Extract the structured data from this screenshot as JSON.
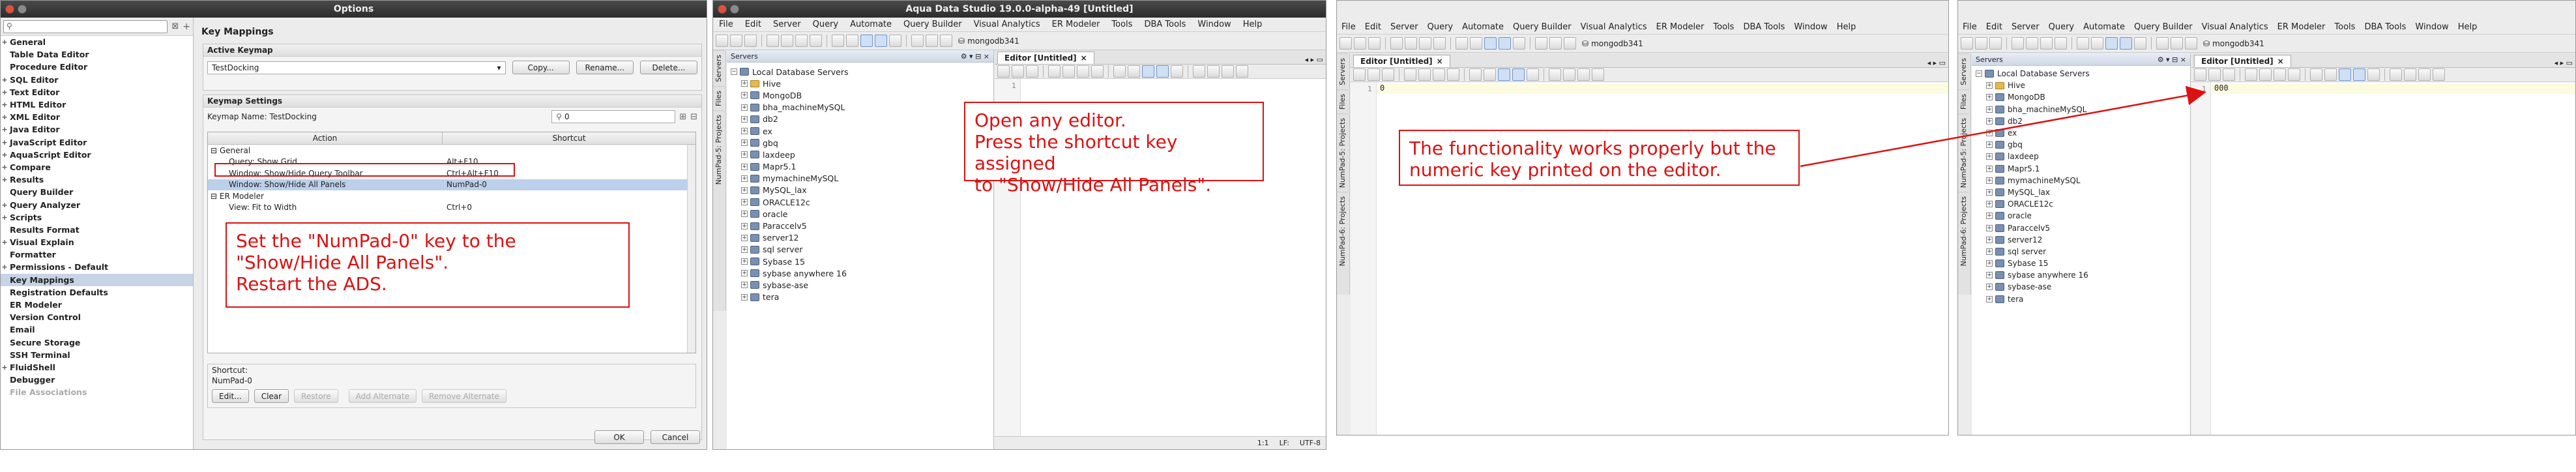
{
  "options": {
    "title": "Options",
    "nav": [
      {
        "label": "General",
        "pm": "+"
      },
      {
        "label": "Table Data Editor",
        "pm": ""
      },
      {
        "label": "Procedure Editor",
        "pm": ""
      },
      {
        "label": "SQL Editor",
        "pm": "+"
      },
      {
        "label": "Text Editor",
        "pm": "+"
      },
      {
        "label": "HTML Editor",
        "pm": "+"
      },
      {
        "label": "XML Editor",
        "pm": "+"
      },
      {
        "label": "Java Editor",
        "pm": "+"
      },
      {
        "label": "JavaScript Editor",
        "pm": "+"
      },
      {
        "label": "AquaScript Editor",
        "pm": "+"
      },
      {
        "label": "Compare",
        "pm": "+"
      },
      {
        "label": "Results",
        "pm": "+"
      },
      {
        "label": "Query Builder",
        "pm": ""
      },
      {
        "label": "Query Analyzer",
        "pm": "+"
      },
      {
        "label": "Scripts",
        "pm": "+"
      },
      {
        "label": "Results Format",
        "pm": ""
      },
      {
        "label": "Visual Explain",
        "pm": "+"
      },
      {
        "label": "Formatter",
        "pm": ""
      },
      {
        "label": "Permissions - Default",
        "pm": "+"
      },
      {
        "label": "Key Mappings",
        "pm": ""
      },
      {
        "label": "Registration Defaults",
        "pm": ""
      },
      {
        "label": "ER Modeler",
        "pm": ""
      },
      {
        "label": "Version Control",
        "pm": ""
      },
      {
        "label": "Email",
        "pm": ""
      },
      {
        "label": "Secure Storage",
        "pm": ""
      },
      {
        "label": "SSH Terminal",
        "pm": ""
      },
      {
        "label": "FluidShell",
        "pm": "+"
      },
      {
        "label": "Debugger",
        "pm": ""
      },
      {
        "label": "File Associations",
        "pm": ""
      }
    ],
    "section_title": "Key Mappings",
    "active_keymap_label": "Active Keymap",
    "active_keymap_value": "TestDocking",
    "copy_btn": "Copy...",
    "rename_btn": "Rename...",
    "delete_btn": "Delete...",
    "keymap_settings_label": "Keymap Settings",
    "keymap_name_label": "Keymap Name: TestDocking",
    "search_value": "0",
    "col_action": "Action",
    "col_shortcut": "Shortcut",
    "rows": [
      {
        "action": "General",
        "shortcut": "",
        "indent": 0,
        "pm": "⊟"
      },
      {
        "action": "Query: Show Grid",
        "shortcut": "Alt+F10",
        "indent": 2,
        "pm": ""
      },
      {
        "action": "Window: Show/Hide Query Toolbar",
        "shortcut": "Ctrl+Alt+F10",
        "indent": 2,
        "pm": ""
      },
      {
        "action": "Window: Show/Hide All Panels",
        "shortcut": "NumPad-0",
        "indent": 2,
        "pm": ""
      },
      {
        "action": "ER Modeler",
        "shortcut": "",
        "indent": 0,
        "pm": "⊟"
      },
      {
        "action": "View: Fit to Width",
        "shortcut": "Ctrl+0",
        "indent": 2,
        "pm": ""
      }
    ],
    "shortcut_group_label": "Shortcut:",
    "shortcut_value": "NumPad-0",
    "edit_btn": "Edit...",
    "clear_btn": "Clear",
    "restore_btn": "Restore",
    "add_alt_btn": "Add Alternate",
    "remove_alt_btn": "Remove Alternate",
    "ok_btn": "OK",
    "cancel_btn": "Cancel",
    "callout": "Set the \"NumPad-0\" key to the \"Show/Hide All Panels\".\nRestart the ADS."
  },
  "ads": {
    "title": "Aqua Data Studio 19.0.0-alpha-49 [Untitled]",
    "menus": [
      "File",
      "Edit",
      "Server",
      "Query",
      "Automate",
      "Query Builder",
      "Visual Analytics",
      "ER Modeler",
      "Tools",
      "DBA Tools",
      "Window",
      "Help"
    ],
    "server_combo": "mongodb341",
    "side_tabs": [
      "Servers",
      "Files",
      "NumPad-5: Projects",
      "NumPad-6: Projects"
    ],
    "side_tabs_short": [
      "Servers",
      "Files",
      "NumPad-5: Projects"
    ],
    "servers_title": "Servers",
    "servers": [
      "Local Database Servers",
      "Hive",
      "MongoDB",
      "bha_machineMySQL",
      "db2",
      "ex",
      "gbq",
      "laxdeep",
      "Mapr5.1",
      "mymachineMySQL",
      "MySQL_lax",
      "ORACLE12c",
      "oracle",
      "Paraccelv5",
      "server12",
      "sql server",
      "Sybase 15",
      "sybase anywhere 16",
      "sybase-ase",
      "tera"
    ],
    "editor_tab": "Editor [Untitled]",
    "line_no": "1",
    "typed_text": "000",
    "typed_text_one": "0",
    "status_pos": "1:1",
    "status_lf": "LF:",
    "status_enc": "UTF-8",
    "callout2": "Open any editor.\nPress the shortcut key assigned\nto \"Show/Hide All Panels\".",
    "callout3": "The functionality works properly but the\nnumeric key printed on the editor."
  },
  "colors": {
    "callout": "#dd1111",
    "selection": "#bcd0ec"
  }
}
